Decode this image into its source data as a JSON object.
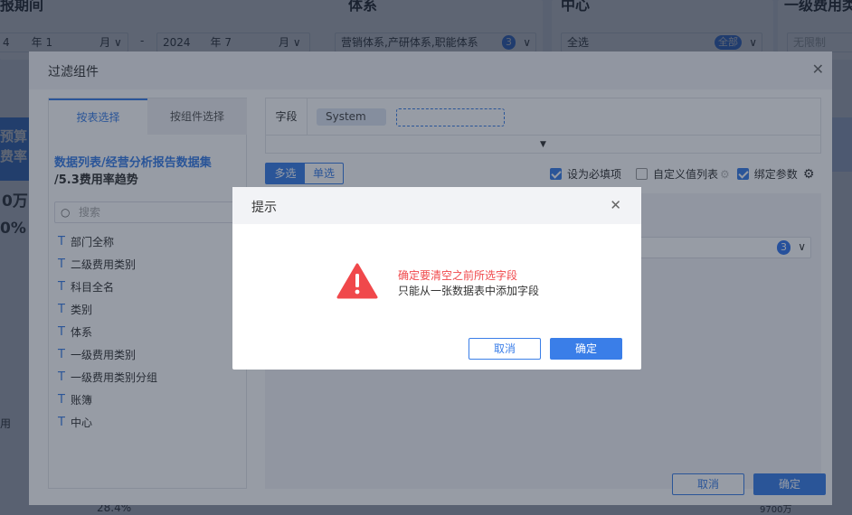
{
  "dashboard": {
    "period_title": "报期间",
    "start_year": "4",
    "year_unit": "年",
    "start_month": "1",
    "month_unit": "月",
    "range_sep": "-",
    "end_year": "2024",
    "end_month": "7",
    "system_title": "体系",
    "system_value": "营销体系,产研体系,职能体系",
    "system_count": "3",
    "center_title": "中心",
    "center_value": "全选",
    "center_badge": "全部",
    "cost_title": "一级费用类",
    "cost_value": "无限制",
    "left_texts": [
      "预算",
      "费率",
      "0万",
      "0%",
      "用"
    ],
    "bottom_pct": "28.4%",
    "right_fragment": "9700万"
  },
  "filter_dialog": {
    "title": "过滤组件",
    "tabs": [
      "按表选择",
      "按组件选择"
    ],
    "dataset_path": "数据列表/经营分析报告数据集",
    "dataset_sub": "/5.3费用率趋势",
    "search_placeholder": "搜索",
    "fields": [
      "部门全称",
      "二级费用类别",
      "科目全名",
      "类别",
      "体系",
      "一级费用类别",
      "一级费用类别分组",
      "账簿",
      "中心"
    ],
    "field_label": "字段",
    "field_chip": "System",
    "mode_multi": "多选",
    "mode_single": "单选",
    "required_label": "设为必填项",
    "custom_list_label": "自定义值列表",
    "bind_param_label": "绑定参数",
    "preview_count": "3",
    "cancel": "取消",
    "confirm": "确定"
  },
  "alert": {
    "title": "提示",
    "message_red": "确定要清空之前所选字段",
    "message": "只能从一张数据表中添加字段",
    "cancel": "取消",
    "confirm": "确定"
  },
  "colors": {
    "primary": "#3a7ee8",
    "danger": "#f0484b"
  }
}
